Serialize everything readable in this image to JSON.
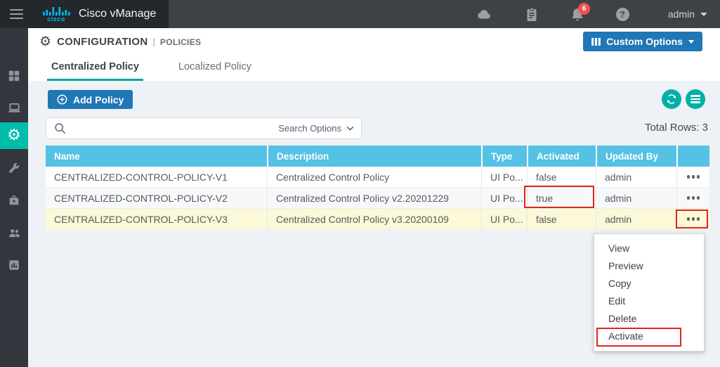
{
  "topbar": {
    "brand": "Cisco vManage",
    "logo_word": "cisco",
    "notification_count": "6",
    "user": "admin"
  },
  "header": {
    "section": "CONFIGURATION",
    "divider": "|",
    "subsection": "POLICIES",
    "custom_options_label": "Custom Options"
  },
  "tabs": [
    {
      "label": "Centralized Policy",
      "active": true
    },
    {
      "label": "Localized Policy",
      "active": false
    }
  ],
  "toolbar": {
    "add_policy_label": "Add Policy",
    "search_value": "",
    "search_options_label": "Search Options",
    "total_rows_label": "Total Rows: 3"
  },
  "table": {
    "columns": [
      "Name",
      "Description",
      "Type",
      "Activated",
      "Updated By"
    ],
    "rows": [
      {
        "name": "CENTRALIZED-CONTROL-POLICY-V1",
        "description": "Centralized Control Policy",
        "type": "UI Po...",
        "activated": "false",
        "updated_by": "admin"
      },
      {
        "name": "CENTRALIZED-CONTROL-POLICY-V2",
        "description": "Centralized Control Policy v2.20201229",
        "type": "UI Po...",
        "activated": "true",
        "updated_by": "admin"
      },
      {
        "name": "CENTRALIZED-CONTROL-POLICY-V3",
        "description": "Centralized Control Policy v3.20200109",
        "type": "UI Po...",
        "activated": "false",
        "updated_by": "admin"
      }
    ]
  },
  "context_menu": {
    "items": [
      "View",
      "Preview",
      "Copy",
      "Edit",
      "Delete",
      "Activate"
    ]
  },
  "icons": {
    "topbar": [
      "menu-icon",
      "cloud-icon",
      "tasks-icon",
      "notifications-icon",
      "help-icon"
    ],
    "sidebar": [
      "dashboard-icon",
      "monitor-icon",
      "configuration-gear-icon",
      "tools-icon",
      "maintenance-icon",
      "administration-icon",
      "vanalytics-icon"
    ]
  },
  "colors": {
    "accent_teal": "#00a89b",
    "sidebar_active_teal": "#00bcab",
    "primary_blue": "#2077b6",
    "table_header_blue": "#55c1e4",
    "annotation_red": "#e02420",
    "badge_red": "#f1544b",
    "row_highlight_yellow": "#fbf9d8",
    "topbar_dark": "#3d4247",
    "topbar_brand_dark": "#24282c",
    "sidebar_dark": "#33363c"
  }
}
